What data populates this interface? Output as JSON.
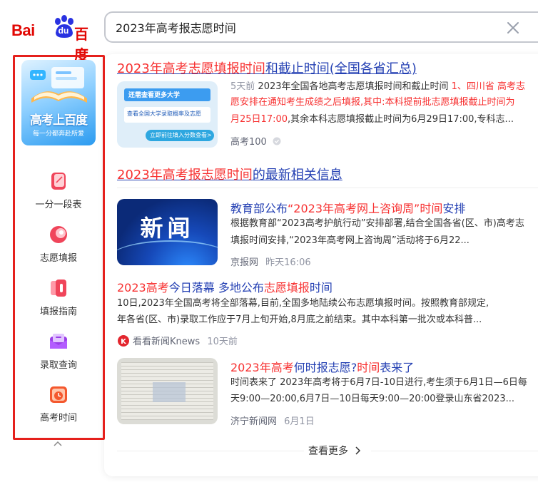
{
  "logo": {
    "latin": "Bai",
    "paw_text": "du",
    "chinese": "百度"
  },
  "search": {
    "query": "2023年高考报志愿时间",
    "clear_icon": "close-icon"
  },
  "sidebar": {
    "banner": {
      "title": "高考上百度",
      "subtitle": "每一分都奔赴所爱"
    },
    "tools": [
      {
        "label": "一分一段表",
        "icon": "chart-doc-icon",
        "color": "#f0455a"
      },
      {
        "label": "志愿填报",
        "icon": "target-icon",
        "color": "#f0455a"
      },
      {
        "label": "填报指南",
        "icon": "guide-book-icon",
        "color": "#f0455a"
      },
      {
        "label": "录取查询",
        "icon": "envelope-icon",
        "color": "#9b3ee8"
      },
      {
        "label": "高考时间",
        "icon": "clock-icon",
        "color": "#f4582e"
      }
    ],
    "collapse_icon": "chevron-up-icon"
  },
  "results": {
    "r1": {
      "title_red": "2023年高考志愿填报时间",
      "title_blue": "和截止时间(全国各省汇总)",
      "thumb_line1": "还需查看更多大学",
      "thumb_line2": "查看全国大学录取概率及志愿",
      "thumb_line3": "立即前往填入分数查看>",
      "age": "5天前",
      "l1_a": "2023年全国各地高考志愿填报时间和截止时间 ",
      "l1_b": "1、四川省 高考志",
      "l2": "愿安排在通知考生成绩之后填报,其中:本科提前批志愿填报截止时间为",
      "l3_a": "月25日17:00",
      "l3_b": ",其余本科志愿填报截止时间为6月29日17:00,专科志...",
      "source": "高考100"
    },
    "section": {
      "title_red": "2023年高考报志愿时间",
      "title_blue": "的最新相关信息"
    },
    "n1": {
      "thumb_text": "新闻",
      "title_a": "教育部公布",
      "title_b": "“2023年高考网上咨询周”时间",
      "title_c": "安排",
      "l1": "根据教育部“2023高考护航行动”安排部署,结合全国各省(区、市)高考志",
      "l2": "填报时间安排,“2023年高考网上咨询周”活动将于6月22...",
      "source": "京报网",
      "time": "昨天16:06"
    },
    "n2": {
      "title_a": "2023高考",
      "title_b": "今日落幕 多地公布",
      "title_c": "志愿填报",
      "title_d": "时间",
      "l1": "10日,2023年全国高考将全部落幕,目前,全国多地陆续公布志愿填报时间。按照教育部规定,",
      "l2": "年各省(区、市)录取工作应于7月上旬开始,8月底之前结束。其中本科第一批次或本科普...",
      "source": "看看新闻Knews",
      "time": "10天前"
    },
    "n3": {
      "title_a": "2023年高考",
      "title_b": "何时报志愿?",
      "title_c": "时间",
      "title_d": "表来了",
      "l1": "时间表来了 2023年高考将于6月7日-10日进行,考生须于6月1日—6日每",
      "l2": "天9:00—20:00,6月7日—10日每天9:00—20:00登录山东省2023...",
      "source": "济宁新闻网",
      "time": "6月1日"
    },
    "more_label": "查看更多",
    "more_icon": "chevron-right-icon"
  }
}
